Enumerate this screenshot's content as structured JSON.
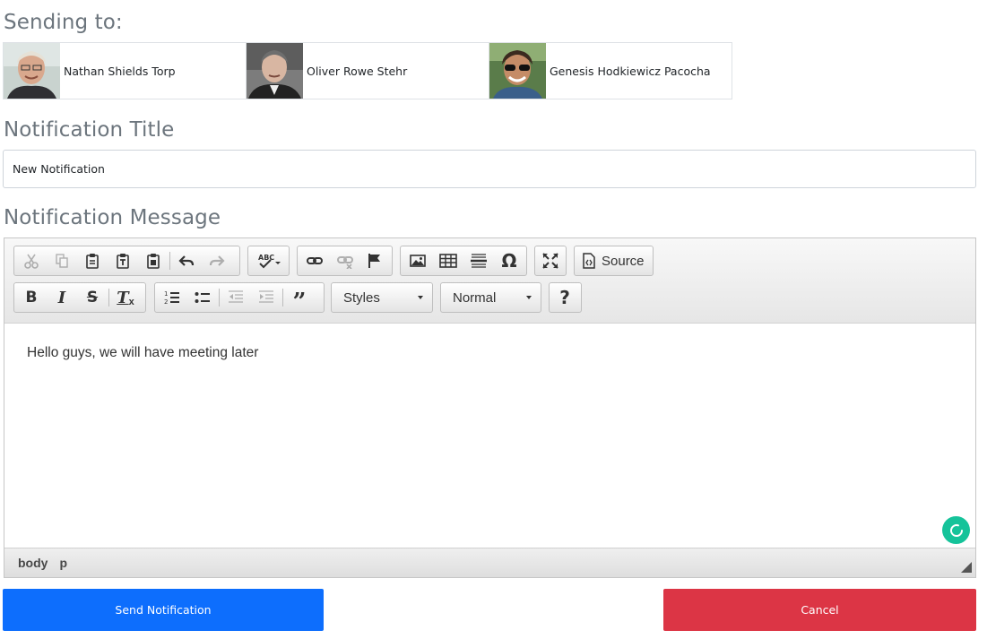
{
  "headings": {
    "sending_to": "Sending to:",
    "title": "Notification Title",
    "message": "Notification Message"
  },
  "recipients": [
    {
      "name": "Nathan Shields Torp",
      "avatar": "avatar-photo"
    },
    {
      "name": "Oliver Rowe Stehr",
      "avatar": "avatar-photo"
    },
    {
      "name": "Genesis Hodkiewicz Pacocha",
      "avatar": "avatar-photo"
    }
  ],
  "title_input": {
    "value": "New Notification"
  },
  "editor": {
    "toolbar": {
      "source_label": "Source",
      "styles_label": "Styles",
      "format_label": "Normal"
    },
    "content": "Hello guys, we will have meeting later",
    "path": [
      "body",
      "p"
    ]
  },
  "actions": {
    "send_label": "Send Notification",
    "cancel_label": "Cancel"
  },
  "colors": {
    "send": "#0d6efd",
    "cancel": "#dc3545",
    "grammarly": "#15c39a"
  }
}
